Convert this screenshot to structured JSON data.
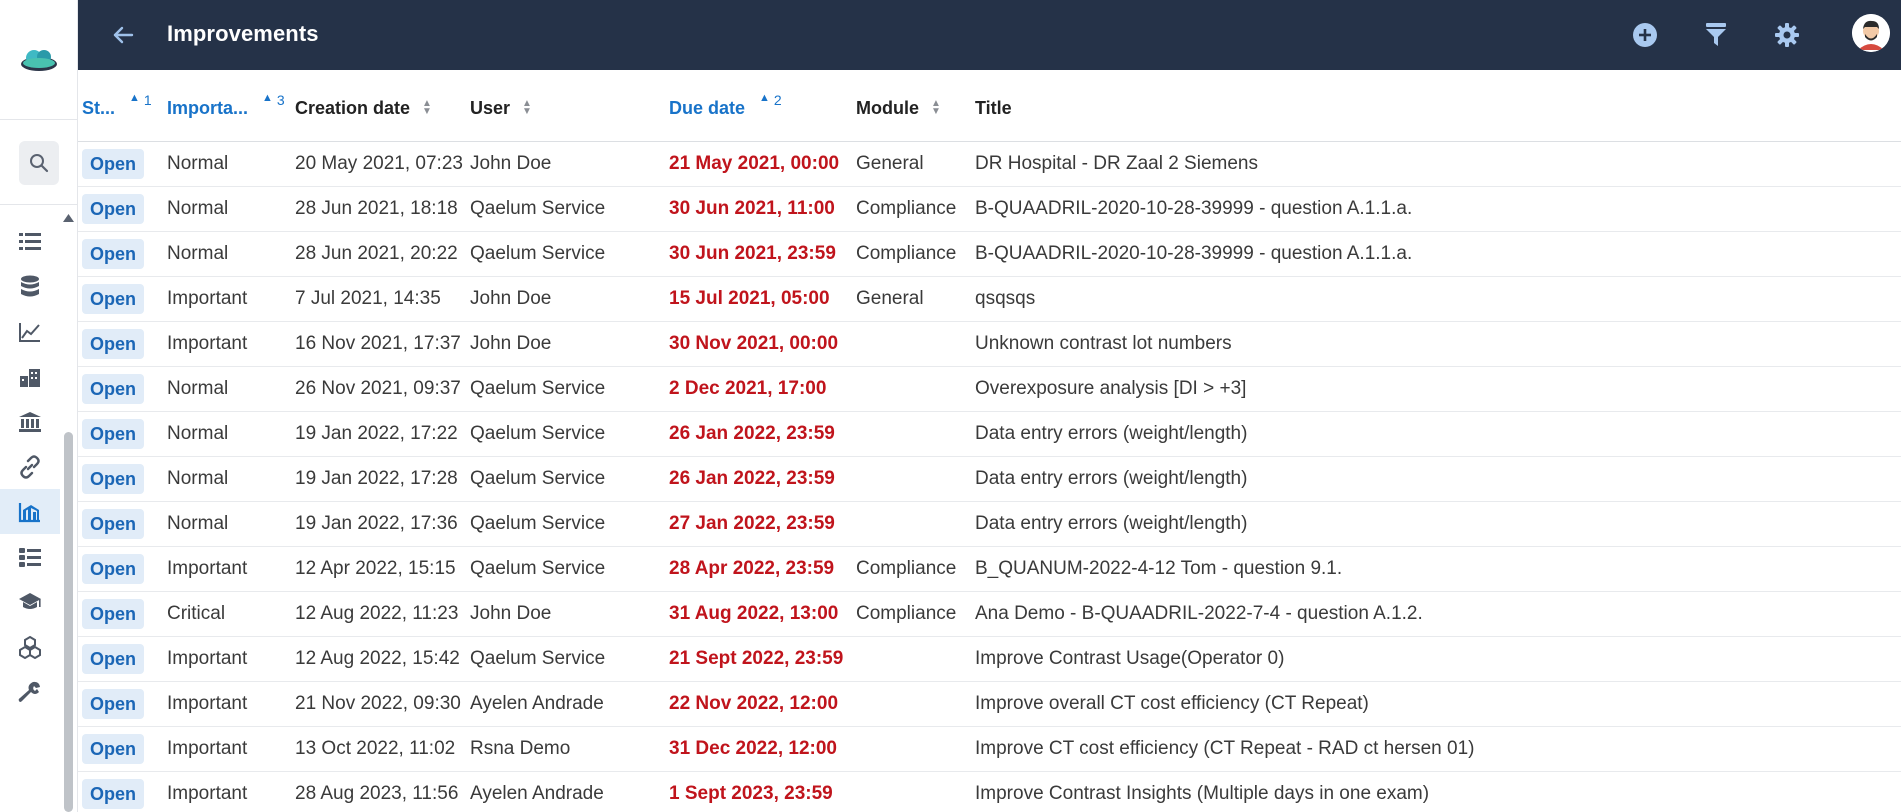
{
  "app": {
    "title": "Improvements"
  },
  "colors": {
    "topbar": "#253248",
    "accent": "#1873c9",
    "due": "#c0141c",
    "badge_bg": "#e1ecf8"
  },
  "sidebar": {
    "items": [
      {
        "name": "list-icon",
        "active": false
      },
      {
        "name": "database-icon",
        "active": false
      },
      {
        "name": "line-chart-icon",
        "active": false
      },
      {
        "name": "building-icon",
        "active": false
      },
      {
        "name": "bank-icon",
        "active": false
      },
      {
        "name": "link-icon",
        "active": false
      },
      {
        "name": "factory-chart-icon",
        "active": true
      },
      {
        "name": "tasks-list-icon",
        "active": false
      },
      {
        "name": "graduation-cap-icon",
        "active": false
      },
      {
        "name": "cubes-icon",
        "active": false
      },
      {
        "name": "wrench-icon",
        "active": false
      }
    ]
  },
  "toolbar": {
    "icons": [
      "add-icon",
      "filter-icon",
      "settings-gear-icon",
      "user-avatar"
    ]
  },
  "table": {
    "columns": [
      {
        "label": "St...",
        "sort": "asc",
        "order": "1"
      },
      {
        "label": "Importa...",
        "sort": "asc",
        "order": "3"
      },
      {
        "label": "Creation date",
        "sort": "none",
        "order": ""
      },
      {
        "label": "User",
        "sort": "none",
        "order": ""
      },
      {
        "label": "Due date",
        "sort": "asc",
        "order": "2"
      },
      {
        "label": "Module",
        "sort": "none",
        "order": ""
      },
      {
        "label": "Title",
        "sort": "",
        "order": ""
      }
    ],
    "rows": [
      {
        "status": "Open",
        "importance": "Normal",
        "created": "20 May 2021, 07:23",
        "user": "John Doe",
        "due": "21 May 2021, 00:00",
        "module": "General",
        "title": "DR Hospital - DR Zaal 2 Siemens"
      },
      {
        "status": "Open",
        "importance": "Normal",
        "created": "28 Jun 2021, 18:18",
        "user": "Qaelum Service",
        "due": "30 Jun 2021, 11:00",
        "module": "Compliance",
        "title": "B-QUAADRIL-2020-10-28-39999 - question A.1.1.a."
      },
      {
        "status": "Open",
        "importance": "Normal",
        "created": "28 Jun 2021, 20:22",
        "user": "Qaelum Service",
        "due": "30 Jun 2021, 23:59",
        "module": "Compliance",
        "title": "B-QUAADRIL-2020-10-28-39999 - question A.1.1.a."
      },
      {
        "status": "Open",
        "importance": "Important",
        "created": "7 Jul 2021, 14:35",
        "user": "John Doe",
        "due": "15 Jul 2021, 05:00",
        "module": "General",
        "title": "qsqsqs"
      },
      {
        "status": "Open",
        "importance": "Important",
        "created": "16 Nov 2021, 17:37",
        "user": "John Doe",
        "due": "30 Nov 2021, 00:00",
        "module": "",
        "title": "Unknown contrast lot numbers"
      },
      {
        "status": "Open",
        "importance": "Normal",
        "created": "26 Nov 2021, 09:37",
        "user": "Qaelum Service",
        "due": "2 Dec 2021, 17:00",
        "module": "",
        "title": "Overexposure analysis [DI > +3]"
      },
      {
        "status": "Open",
        "importance": "Normal",
        "created": "19 Jan 2022, 17:22",
        "user": "Qaelum Service",
        "due": "26 Jan 2022, 23:59",
        "module": "",
        "title": "Data entry errors (weight/length)"
      },
      {
        "status": "Open",
        "importance": "Normal",
        "created": "19 Jan 2022, 17:28",
        "user": "Qaelum Service",
        "due": "26 Jan 2022, 23:59",
        "module": "",
        "title": "Data entry errors (weight/length)"
      },
      {
        "status": "Open",
        "importance": "Normal",
        "created": "19 Jan 2022, 17:36",
        "user": "Qaelum Service",
        "due": "27 Jan 2022, 23:59",
        "module": "",
        "title": "Data entry errors (weight/length)"
      },
      {
        "status": "Open",
        "importance": "Important",
        "created": "12 Apr 2022, 15:15",
        "user": "Qaelum Service",
        "due": "28 Apr 2022, 23:59",
        "module": "Compliance",
        "title": "B_QUANUM-2022-4-12 Tom - question 9.1."
      },
      {
        "status": "Open",
        "importance": "Critical",
        "created": "12 Aug 2022, 11:23",
        "user": "John Doe",
        "due": "31 Aug 2022, 13:00",
        "module": "Compliance",
        "title": "Ana Demo - B-QUAADRIL-2022-7-4 - question A.1.2."
      },
      {
        "status": "Open",
        "importance": "Important",
        "created": "12 Aug 2022, 15:42",
        "user": "Qaelum Service",
        "due": "21 Sept 2022, 23:59",
        "module": "",
        "title": "Improve Contrast Usage(Operator 0)"
      },
      {
        "status": "Open",
        "importance": "Important",
        "created": "21 Nov 2022, 09:30",
        "user": "Ayelen Andrade",
        "due": "22 Nov 2022, 12:00",
        "module": "",
        "title": "Improve overall CT cost efficiency (CT Repeat)"
      },
      {
        "status": "Open",
        "importance": "Important",
        "created": "13 Oct 2022, 11:02",
        "user": "Rsna Demo",
        "due": "31 Dec 2022, 12:00",
        "module": "",
        "title": "Improve CT cost efficiency (CT Repeat - RAD ct hersen 01)"
      },
      {
        "status": "Open",
        "importance": "Important",
        "created": "28 Aug 2023, 11:56",
        "user": "Ayelen Andrade",
        "due": "1 Sept 2023, 23:59",
        "module": "",
        "title": "Improve Contrast Insights (Multiple days in one exam)"
      }
    ]
  }
}
